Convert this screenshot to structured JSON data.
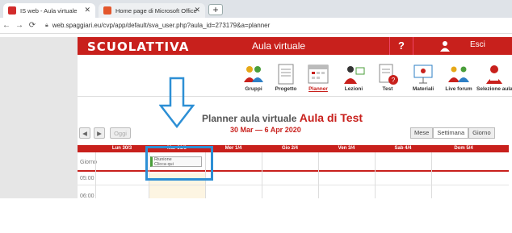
{
  "browser": {
    "tabs": [
      {
        "title": "IS web - Aula virtuale",
        "active": true,
        "favicon_color": "#d22b2b"
      },
      {
        "title": "Home page di Microsoft Office",
        "active": false,
        "favicon_color": "#e3562b"
      }
    ],
    "new_tab_label": "+",
    "url": "web.spaggiari.eu/cvp/app/default/sva_user.php?aula_id=273179&a=planner"
  },
  "site": {
    "logo": "SCUOLATTIVA",
    "app_name": "Aula virtuale",
    "help_label": "?",
    "exit_label": "Esci",
    "brand_color": "#c8201c"
  },
  "toolbar": {
    "items": [
      {
        "label": "Gruppi",
        "icon": "group-icon"
      },
      {
        "label": "Progetto",
        "icon": "document-icon"
      },
      {
        "label": "Planner",
        "icon": "calendar-icon",
        "active": true
      },
      {
        "label": "Lezioni",
        "icon": "teacher-icon"
      },
      {
        "label": "Test",
        "icon": "test-icon"
      },
      {
        "label": "Materiali",
        "icon": "presentation-icon"
      },
      {
        "label": "Live forum",
        "icon": "forum-icon"
      },
      {
        "label": "Selezione aula",
        "icon": "select-class-icon"
      }
    ]
  },
  "planner": {
    "title": "Planner aula virtuale",
    "class_name": "Aula di Test",
    "date_range": "30 Mar — 6 Apr 2020",
    "prev_label": "◀",
    "next_label": "▶",
    "today_label": "Oggi",
    "views": [
      "Mese",
      "Settimana",
      "Giorno"
    ],
    "selected_view": "Settimana",
    "columns": [
      "Lun 30/3",
      "Mar 31/3",
      "Mer 1/4",
      "Gio 2/4",
      "Ven 3/4",
      "Sab 4/4",
      "Dom 5/4"
    ],
    "rows": [
      "Giorno",
      "05:00",
      "06:00"
    ],
    "event": {
      "line1": "Riunione",
      "line2": "Clicca qui"
    }
  }
}
